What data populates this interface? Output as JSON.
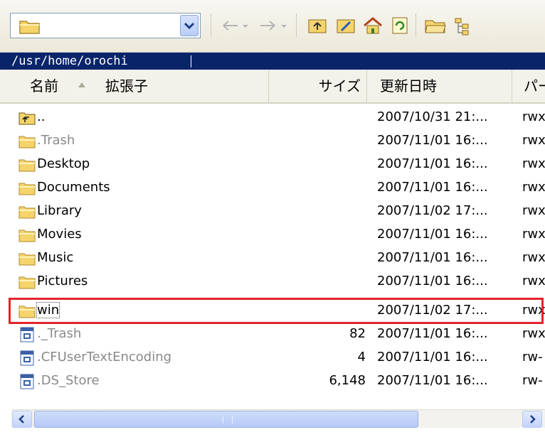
{
  "path": "/usr/home/orochi",
  "columns": {
    "name": "名前",
    "ext": "拡張子",
    "size": "サイズ",
    "date": "更新日時",
    "perm": "パー"
  },
  "rows": [
    {
      "name": "..",
      "size": "",
      "date": "2007/10/31 21:...",
      "perm": "rwx"
    },
    {
      "name": ".Trash",
      "size": "",
      "date": "2007/11/01 16:...",
      "perm": "rwx"
    },
    {
      "name": "Desktop",
      "size": "",
      "date": "2007/11/01 16:...",
      "perm": "rwx"
    },
    {
      "name": "Documents",
      "size": "",
      "date": "2007/11/01 16:...",
      "perm": "rwx"
    },
    {
      "name": "Library",
      "size": "",
      "date": "2007/11/02 17:...",
      "perm": "rwx"
    },
    {
      "name": "Movies",
      "size": "",
      "date": "2007/11/01 16:...",
      "perm": "rwx"
    },
    {
      "name": "Music",
      "size": "",
      "date": "2007/11/01 16:...",
      "perm": "rwx"
    },
    {
      "name": "Pictures",
      "size": "",
      "date": "2007/11/01 16:...",
      "perm": "rwx"
    },
    {
      "name": "win",
      "size": "",
      "date": "2007/11/02 17:...",
      "perm": "rwx"
    },
    {
      "name": "._Trash",
      "size": "82",
      "date": "2007/11/01 16:...",
      "perm": "rwx"
    },
    {
      "name": ".CFUserTextEncoding",
      "size": "4",
      "date": "2007/11/01 16:...",
      "perm": "rw-"
    },
    {
      "name": ".DS_Store",
      "size": "6,148",
      "date": "2007/11/01 16:...",
      "perm": "rw-"
    }
  ],
  "icons": {
    "up": "up-folder-icon",
    "folder": "folder-icon",
    "file": "file-icon"
  },
  "colors": {
    "path_bg": "#0a246a",
    "highlight": "#e4232a",
    "folder": "#f5d46b"
  }
}
